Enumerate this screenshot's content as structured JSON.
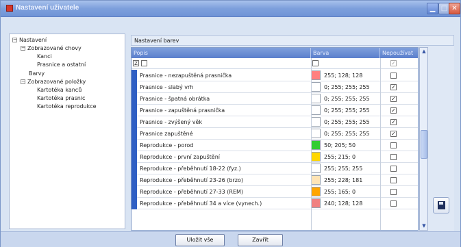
{
  "window": {
    "title": "Nastavení uživatele"
  },
  "tree": {
    "items": [
      {
        "label": "Nastavení",
        "expander": "−"
      },
      {
        "label": "Zobrazované chovy",
        "expander": "−"
      },
      {
        "label": "Kanci"
      },
      {
        "label": "Prasnice a ostatní"
      },
      {
        "label": "Barvy"
      },
      {
        "label": "Zobrazované položky",
        "expander": "−"
      },
      {
        "label": "Kartotéka kanců"
      },
      {
        "label": "Kartotéka prasnic"
      },
      {
        "label": "Kartotéka reprodukce"
      }
    ]
  },
  "panel": {
    "title": "Nastavení barev"
  },
  "grid": {
    "columns": {
      "popis": "Popis",
      "barva": "Barva",
      "nepouzivat": "Nepoužívat"
    },
    "filter_icon": "filter-icon",
    "rows": [
      {
        "popis": "Prasnice - nezapuštěná prasnička",
        "barva": "255; 128; 128",
        "color": "#ff8080",
        "nepouzivat": false
      },
      {
        "popis": "Prasnice - slabý vrh",
        "barva": "0; 255; 255; 255",
        "color": "#ffffff",
        "nepouzivat": true
      },
      {
        "popis": "Prasnice - špatná obrátka",
        "barva": "0; 255; 255; 255",
        "color": "#ffffff",
        "nepouzivat": true
      },
      {
        "popis": "Prasnice - zapuštěná prasnička",
        "barva": "0; 255; 255; 255",
        "color": "#ffffff",
        "nepouzivat": true
      },
      {
        "popis": "Prasnice - zvýšený věk",
        "barva": "0; 255; 255; 255",
        "color": "#ffffff",
        "nepouzivat": true
      },
      {
        "popis": "Prasnice zapuštěné",
        "barva": "0; 255; 255; 255",
        "color": "#ffffff",
        "nepouzivat": true
      },
      {
        "popis": "Reprodukce - porod",
        "barva": "50; 205; 50",
        "color": "#32cd32",
        "nepouzivat": false
      },
      {
        "popis": "Reprodukce - první zapuštění",
        "barva": "255; 215; 0",
        "color": "#ffd700",
        "nepouzivat": false
      },
      {
        "popis": "Reprodukce - přeběhnutí 18-22 (fyz.)",
        "barva": "255; 255; 255",
        "color": "#ffffff",
        "nepouzivat": false
      },
      {
        "popis": "Reprodukce - přeběhnutí 23-26 (brzo)",
        "barva": "255; 228; 181",
        "color": "#ffe4b5",
        "nepouzivat": false
      },
      {
        "popis": "Reprodukce - přeběhnutí 27-33 (REM)",
        "barva": "255; 165; 0",
        "color": "#ffa500",
        "nepouzivat": false
      },
      {
        "popis": "Reprodukce - přeběhnutí 34 a více (vynech.)",
        "barva": "240; 128; 128",
        "color": "#f08080",
        "nepouzivat": false
      }
    ]
  },
  "buttons": {
    "save_all": "Uložit vše",
    "close": "Zavřít"
  },
  "icons": {
    "window_close": "✕",
    "window_min": "▁",
    "window_max": "□",
    "check": "✓",
    "scroll_up": "▲",
    "scroll_down": "▼"
  }
}
